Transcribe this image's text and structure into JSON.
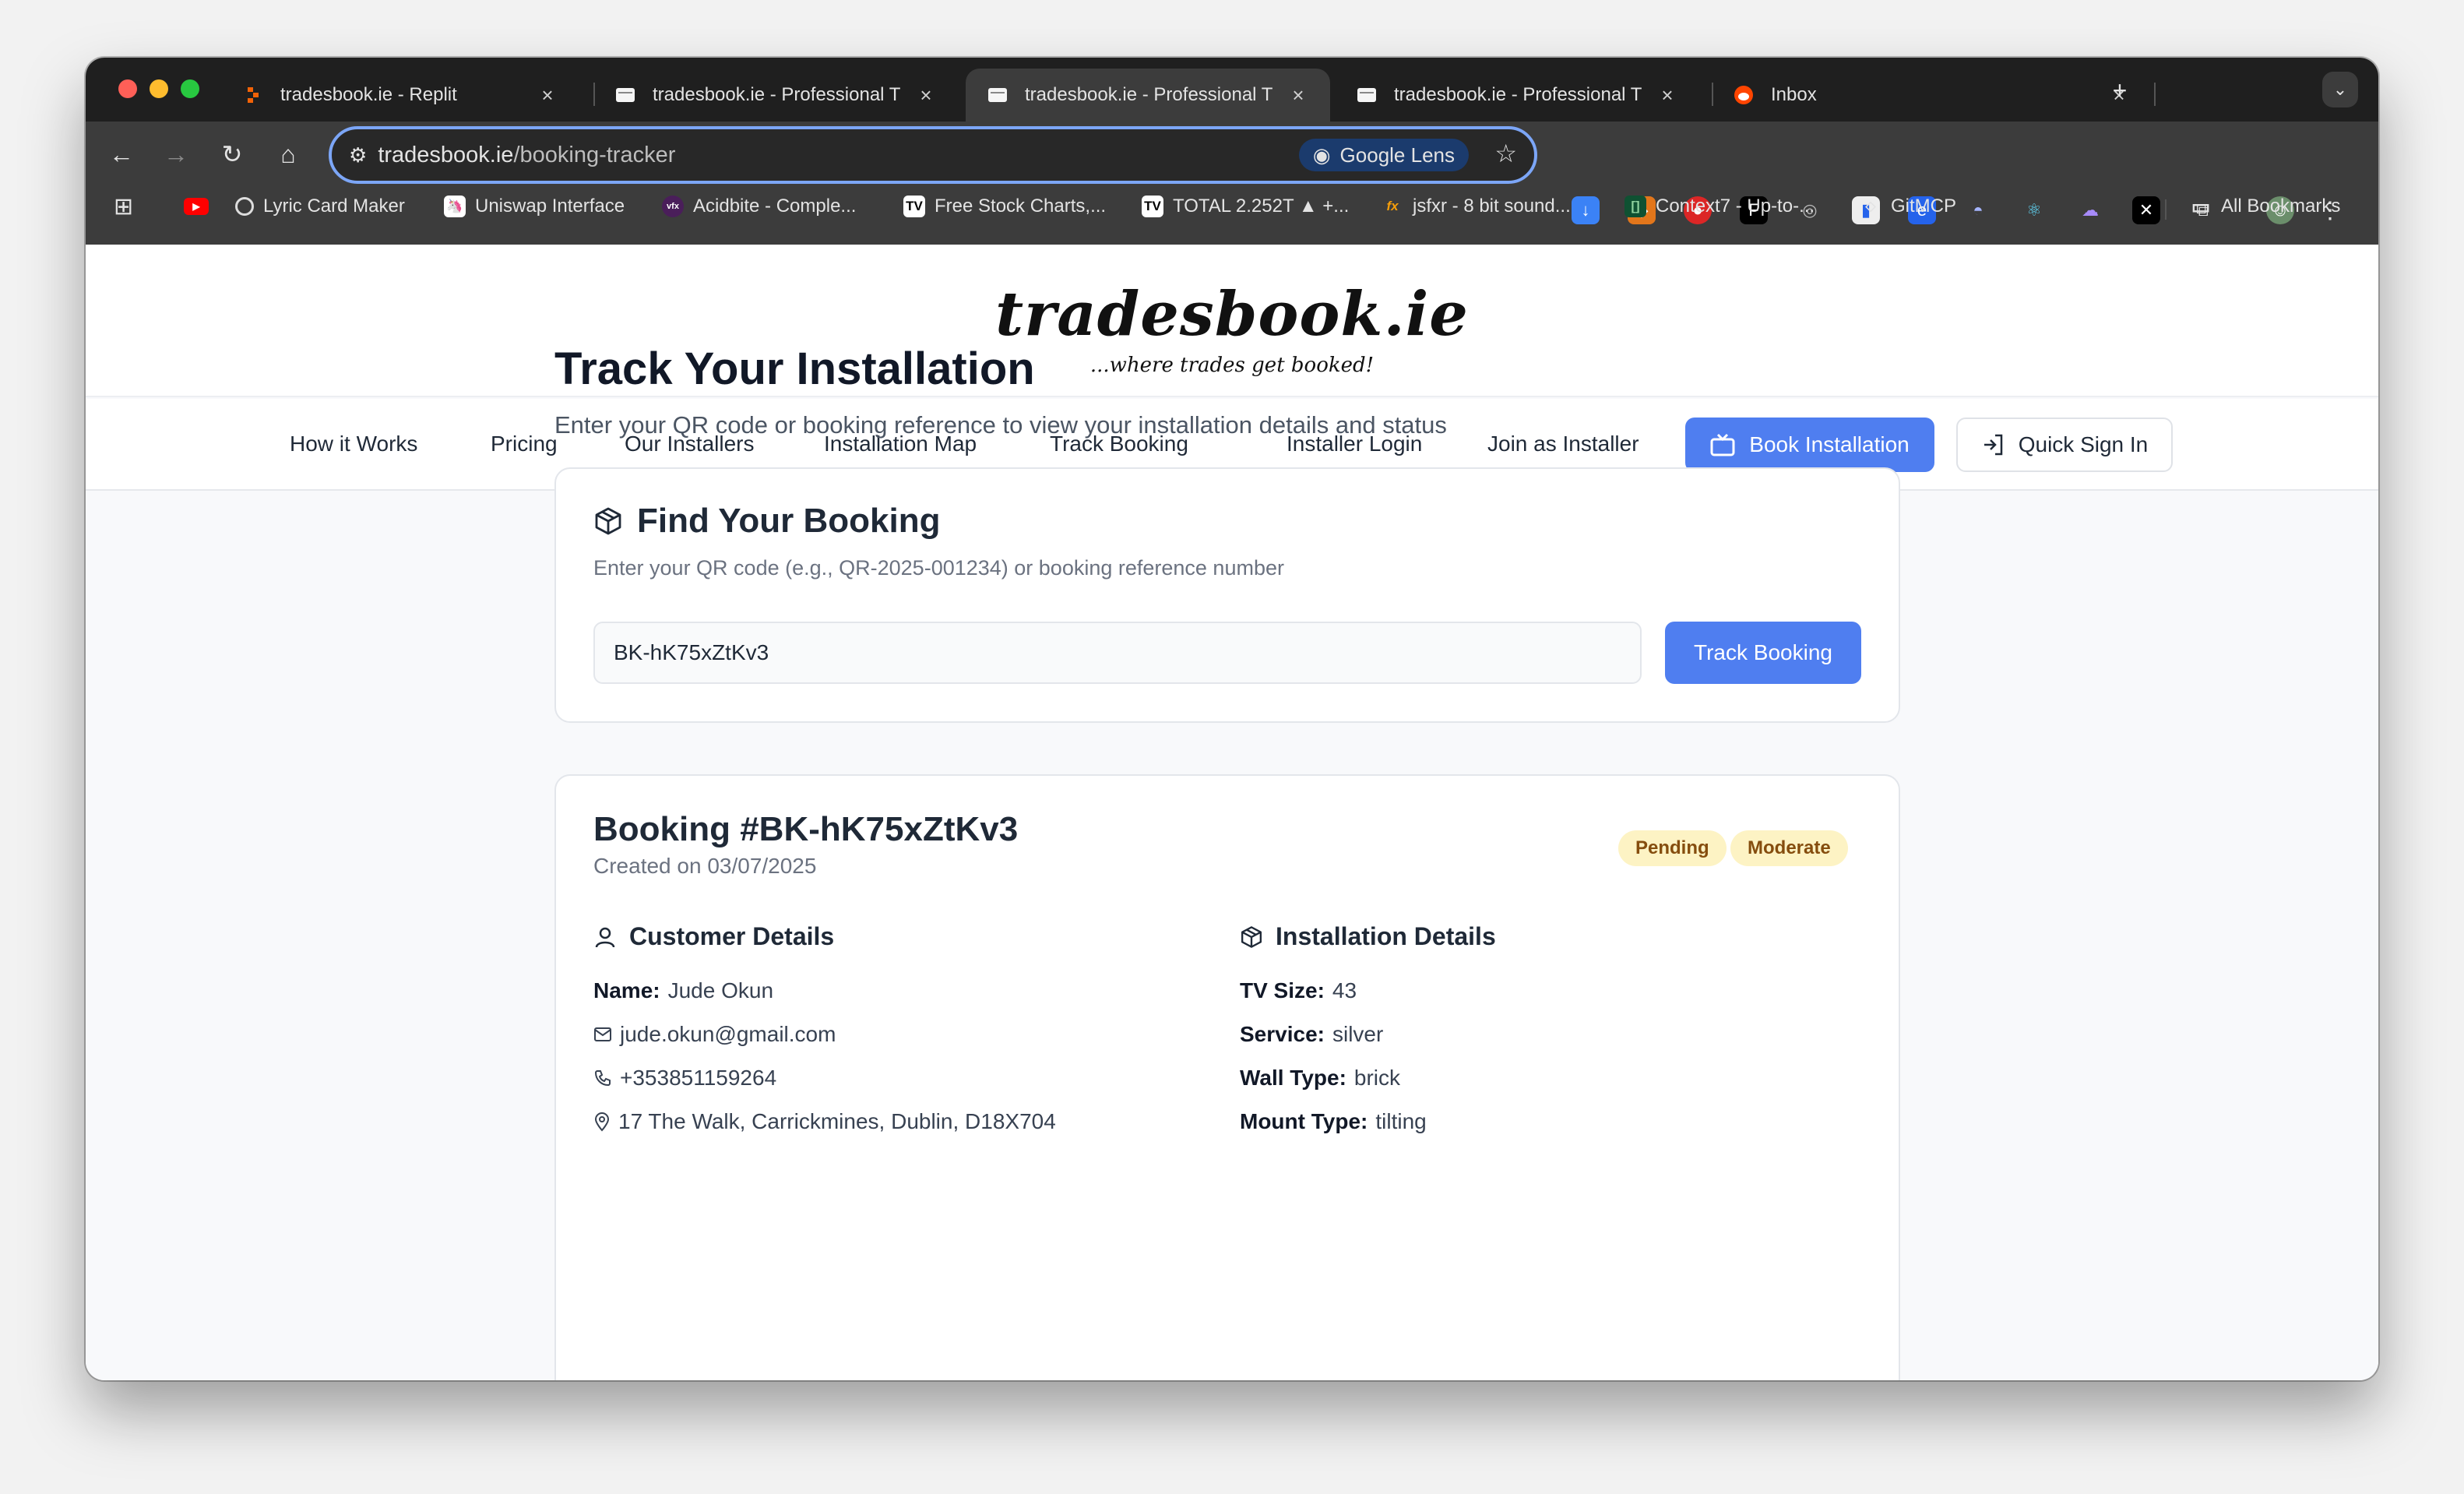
{
  "browser": {
    "tabs": [
      {
        "title": "tradesbook.ie - Replit",
        "favicon": "replit-icon"
      },
      {
        "title": "tradesbook.ie - Professional T",
        "favicon": "site-icon"
      },
      {
        "title": "tradesbook.ie - Professional T",
        "favicon": "site-icon"
      },
      {
        "title": "tradesbook.ie - Professional T",
        "favicon": "site-icon"
      },
      {
        "title": "Inbox",
        "favicon": "reddit-icon"
      }
    ],
    "new_tab": "+",
    "url_host": "tradesbook.ie",
    "url_path": "/booking-tracker",
    "lens_label": "Google Lens",
    "bookmarks": [
      {
        "label": "Lyric Card Maker"
      },
      {
        "label": "Uniswap Interface"
      },
      {
        "label": "Acidbite - Comple..."
      },
      {
        "label": "Free Stock Charts,..."
      },
      {
        "label": "TOTAL 2.252T ▲ +..."
      },
      {
        "label": "jsfxr - 8 bit sound..."
      },
      {
        "label": "Context7 - Up-to-..."
      },
      {
        "label": "GitMCP"
      }
    ],
    "all_bookmarks": "All Bookmarks"
  },
  "site": {
    "logo": "tradesbook.ie",
    "tagline": "...where trades get booked!",
    "nav": [
      "How it Works",
      "Pricing",
      "Our Installers",
      "Installation Map",
      "Track Booking",
      "Installer Login",
      "Join as Installer"
    ],
    "book_button": "Book Installation",
    "signin_button": "Quick Sign In"
  },
  "main": {
    "title": "Track Your Installation",
    "subtitle": "Enter your QR code or booking reference to view your installation details and status",
    "find": {
      "title": "Find Your Booking",
      "description": "Enter your QR code (e.g., QR-2025-001234) or booking reference number",
      "input_value": "BK-hK75xZtKv3",
      "button": "Track Booking"
    },
    "booking": {
      "title": "Booking #BK-hK75xZtKv3",
      "created": "Created on 03/07/2025",
      "status": "Pending",
      "difficulty": "Moderate",
      "customer_title": "Customer Details",
      "name_label": "Name:",
      "name": "Jude Okun",
      "email": "jude.okun@gmail.com",
      "phone": "+353851159264",
      "address": "17 The Walk, Carrickmines, Dublin, D18X704",
      "install_title": "Installation Details",
      "tv_size_label": "TV Size:",
      "tv_size": "43",
      "service_label": "Service:",
      "service": "silver",
      "wall_label": "Wall Type:",
      "wall": "brick",
      "mount_label": "Mount Type:",
      "mount": "tilting"
    }
  }
}
